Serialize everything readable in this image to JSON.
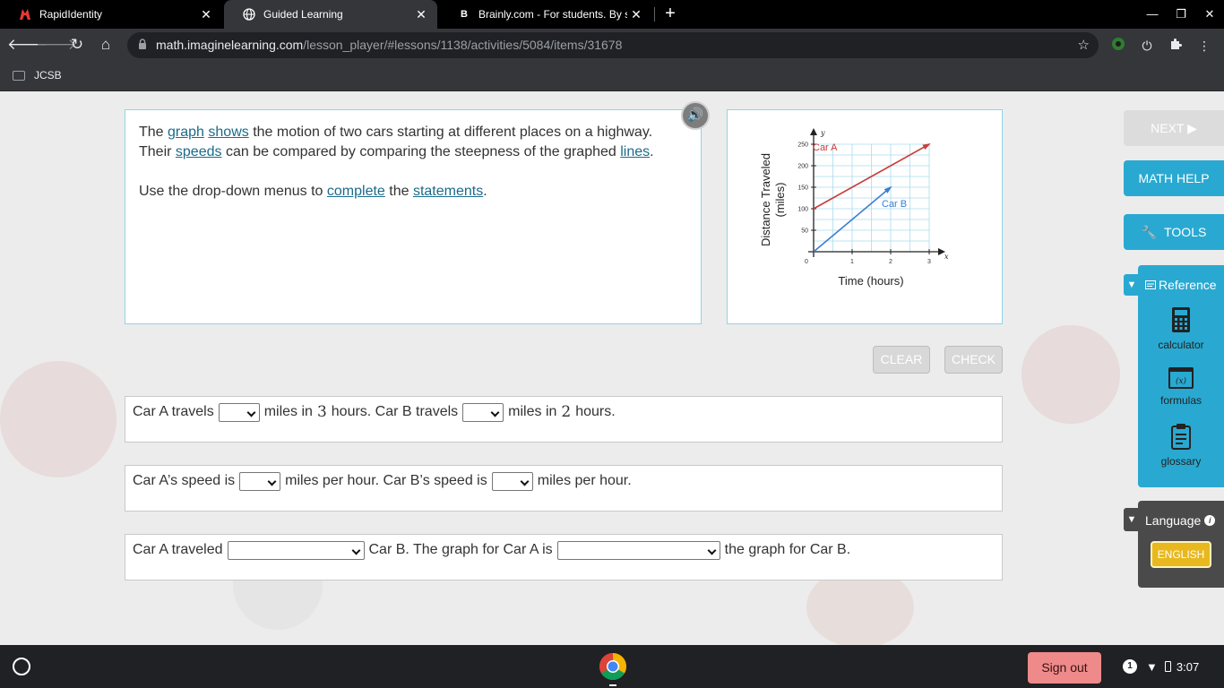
{
  "browser": {
    "tabs": [
      {
        "title": "RapidIdentity",
        "active": false
      },
      {
        "title": "Guided Learning",
        "active": true
      },
      {
        "title": "Brainly.com - For students. By st",
        "active": false
      }
    ],
    "url_host": "math.imaginelearning.com",
    "url_path": "/lesson_player/#lessons/1138/activities/5084/items/31678",
    "bookmarks": [
      {
        "label": "JCSB"
      }
    ]
  },
  "prompt": {
    "sentence1_parts": [
      "The ",
      "graph",
      " ",
      "shows",
      " the motion of two cars starting at different places on a highway. Their ",
      "speeds",
      " can be compared by comparing the steepness of the graphed ",
      "lines",
      "."
    ],
    "sentence2_parts": [
      "Use the drop-down menus to ",
      "complete",
      " the ",
      "statements",
      "."
    ]
  },
  "graph": {
    "xlabel": "Time (hours)",
    "ylabel_line1": "Distance Traveled",
    "ylabel_line2": "(miles)",
    "x_axis_letter": "x",
    "y_axis_letter": "y",
    "x_ticks": [
      "0",
      "1",
      "2",
      "3"
    ],
    "y_ticks": [
      "50",
      "100",
      "150",
      "200",
      "250"
    ],
    "series_labels": {
      "car_a": "Car A",
      "car_b": "Car B"
    },
    "colors": {
      "car_a": "#cc3b3b",
      "car_b": "#3b7fcc",
      "grid": "#a9dcee"
    }
  },
  "chart_data": {
    "type": "line",
    "xlabel": "Time (hours)",
    "ylabel": "Distance Traveled (miles)",
    "xlim": [
      0,
      3
    ],
    "ylim": [
      0,
      250
    ],
    "grid": true,
    "series": [
      {
        "name": "Car A",
        "x": [
          0,
          3
        ],
        "y": [
          100,
          250
        ]
      },
      {
        "name": "Car B",
        "x": [
          0,
          2
        ],
        "y": [
          0,
          150
        ]
      }
    ]
  },
  "actions": {
    "clear_label": "CLEAR",
    "check_label": "CHECK"
  },
  "statements": {
    "s1": {
      "p1": "Car A travels",
      "p2": "miles in",
      "n1": "3",
      "p3": "hours. Car B travels",
      "p4": "miles in",
      "n2": "2",
      "p5": "hours."
    },
    "s2": {
      "p1": "Car A’s speed is",
      "p2": "miles per hour. Car B’s speed is",
      "p3": "miles per hour."
    },
    "s3": {
      "p1": "Car A traveled",
      "p2": "Car B. The graph for Car A is",
      "p3": "the graph for Car B."
    }
  },
  "sidebar": {
    "next_label": "NEXT ▶",
    "math_help_label": "MATH HELP",
    "tools_label": "TOOLS",
    "reference_label": "Reference",
    "reference_items": [
      {
        "label": "calculator"
      },
      {
        "label": "formulas"
      },
      {
        "label": "glossary"
      }
    ],
    "language_label": "Language",
    "english_label": "ENGLISH"
  },
  "shelf": {
    "signout_label": "Sign out",
    "notification_count": "1",
    "time": "3:07"
  }
}
